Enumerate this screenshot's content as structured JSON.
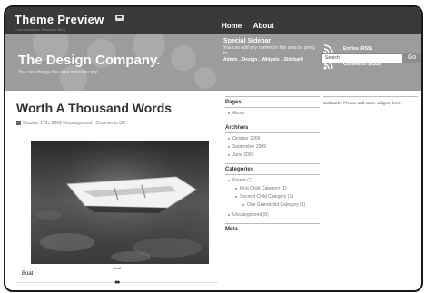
{
  "top_bar": {
    "title": "Theme Preview",
    "subtitle": "Free Installation Resource Blog",
    "nav": [
      "Home",
      "About"
    ]
  },
  "header": {
    "company": "The Design Company.",
    "tagline": "You can change this area in header.php",
    "special": {
      "title": "Special Sidebar",
      "text": "You can add any content in this area by going to",
      "path": "Admin→Design→Widgets→Sidebar4"
    },
    "rss": [
      "Entries (RSS)",
      "Comments (RSS)"
    ],
    "search": {
      "value": "Search",
      "button": "Go"
    }
  },
  "post": {
    "title": "Worth A Thousand Words",
    "meta": "October 17th, 2009  Uncategorized | Comments Off",
    "caption": "Boat",
    "label": "Boat",
    "pager": "●●"
  },
  "sidebar1": {
    "pages": {
      "heading": "Pages",
      "items": [
        "About"
      ]
    },
    "archives": {
      "heading": "Archives",
      "items": [
        "October 2009",
        "September 2009",
        "June 2009"
      ]
    },
    "categories": {
      "heading": "Categories",
      "items": [
        "Parent (1)",
        "First Child Category (1)",
        "Second Child Category (1)",
        "One Grandchild Category (1)",
        "Uncategorized (8)"
      ]
    },
    "meta": {
      "heading": "Meta"
    }
  },
  "sidebar2": {
    "note": "Sidebar2 : Please add some widgets here."
  }
}
